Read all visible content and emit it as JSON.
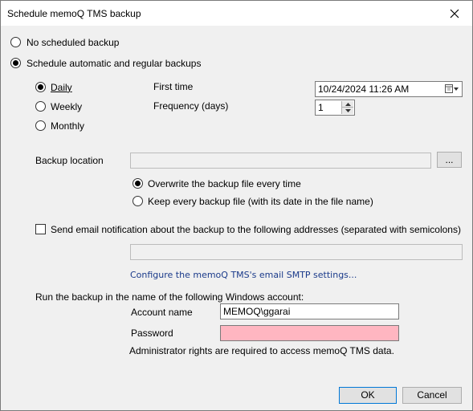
{
  "window": {
    "title": "Schedule memoQ TMS backup"
  },
  "schedule": {
    "none_label": "No scheduled backup",
    "auto_label": "Schedule automatic and regular backups",
    "selected": "auto"
  },
  "frequency_options": {
    "daily": "Daily",
    "weekly": "Weekly",
    "monthly": "Monthly",
    "selected": "daily"
  },
  "first_time": {
    "label": "First time",
    "value": "10/24/2024 11:26 AM"
  },
  "frequency_days": {
    "label": "Frequency (days)",
    "value": "1"
  },
  "backup_location": {
    "label": "Backup location",
    "value": "",
    "browse_label": "..."
  },
  "backup_mode": {
    "overwrite_label": "Overwrite the backup file every time",
    "keep_label": "Keep every backup file (with its date in the file name)",
    "selected": "overwrite"
  },
  "email": {
    "checkbox_label": "Send email notification about the backup to the following addresses (separated with semicolons)",
    "checked": false,
    "addresses": "",
    "smtp_link": "Configure the memoQ TMS's email SMTP settings..."
  },
  "account": {
    "heading": "Run the backup in the name of the following Windows account:",
    "name_label": "Account name",
    "name_value": "MEMOQ\\ggarai",
    "password_label": "Password",
    "password_value": "",
    "note": "Administrator rights are required to access memoQ TMS data."
  },
  "buttons": {
    "ok": "OK",
    "cancel": "Cancel"
  }
}
